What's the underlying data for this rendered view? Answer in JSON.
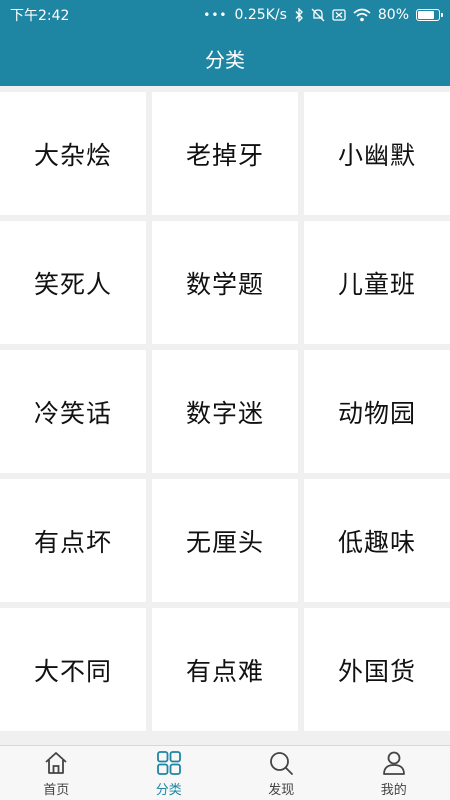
{
  "status_bar": {
    "time": "下午2:42",
    "dots": "•••",
    "net_speed": "0.25K/s",
    "battery_percent": "80%",
    "battery_level": 0.8,
    "icons": [
      "bluetooth-icon",
      "mute-icon",
      "sim-off-icon",
      "wifi-icon",
      "battery-icon"
    ]
  },
  "header": {
    "title": "分类"
  },
  "categories": [
    "大杂烩",
    "老掉牙",
    "小幽默",
    "笑死人",
    "数学题",
    "儿童班",
    "冷笑话",
    "数字迷",
    "动物园",
    "有点坏",
    "无厘头",
    "低趣味",
    "大不同",
    "有点难",
    "外国货"
  ],
  "bottom_nav": {
    "active_index": 1,
    "active_color": "#1e86a3",
    "items": [
      {
        "label": "首页",
        "icon": "home-icon"
      },
      {
        "label": "分类",
        "icon": "grid-icon"
      },
      {
        "label": "发现",
        "icon": "search-icon"
      },
      {
        "label": "我的",
        "icon": "user-icon"
      }
    ]
  },
  "colors": {
    "primary": "#1e86a3",
    "background": "#f0f0f0"
  }
}
